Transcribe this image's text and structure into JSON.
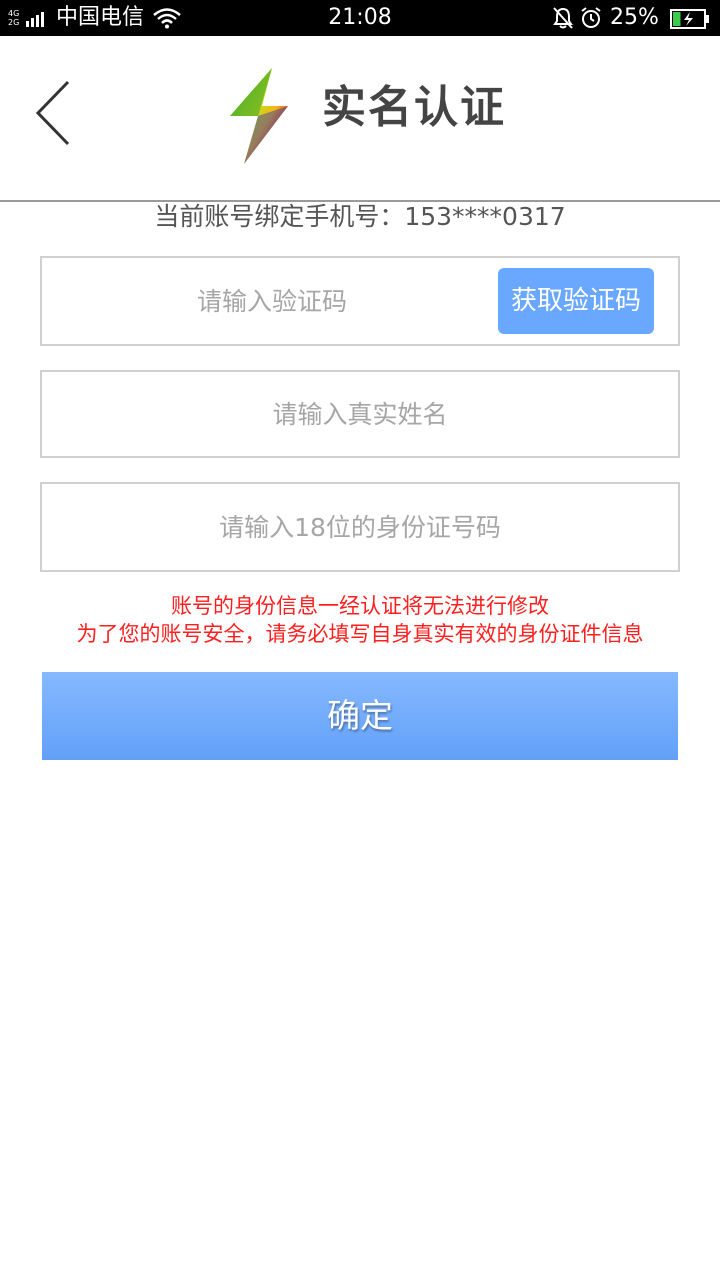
{
  "status_bar": {
    "network_top": "4G",
    "network_bottom": "2G",
    "carrier": "中国电信",
    "time": "21:08",
    "battery_percent": "25%",
    "battery_level": 0.25,
    "icons": [
      "signal-icon",
      "wifi-icon",
      "mute-bell-icon",
      "alarm-icon",
      "battery-icon"
    ]
  },
  "header": {
    "title": "实名认证",
    "back_icon": "chevron-left-icon",
    "logo_icon": "lightning-logo-icon"
  },
  "form": {
    "phone_info": "当前账号绑定手机号：153****0317",
    "code_placeholder": "请输入验证码",
    "code_button": "获取验证码",
    "name_placeholder": "请输入真实姓名",
    "id_placeholder": "请输入18位的身份证号码",
    "warning_line1": "账号的身份信息一经认证将无法进行修改",
    "warning_line2": "为了您的账号安全，请务必填写自身真实有效的身份证件信息",
    "confirm_button": "确定"
  },
  "colors": {
    "accent": "#6aa8ff",
    "warning": "#ff1f1f",
    "title": "#444444",
    "placeholder": "#a6a6a6",
    "status_bar_bg": "#000000",
    "battery_fill": "#3ccb4a"
  }
}
